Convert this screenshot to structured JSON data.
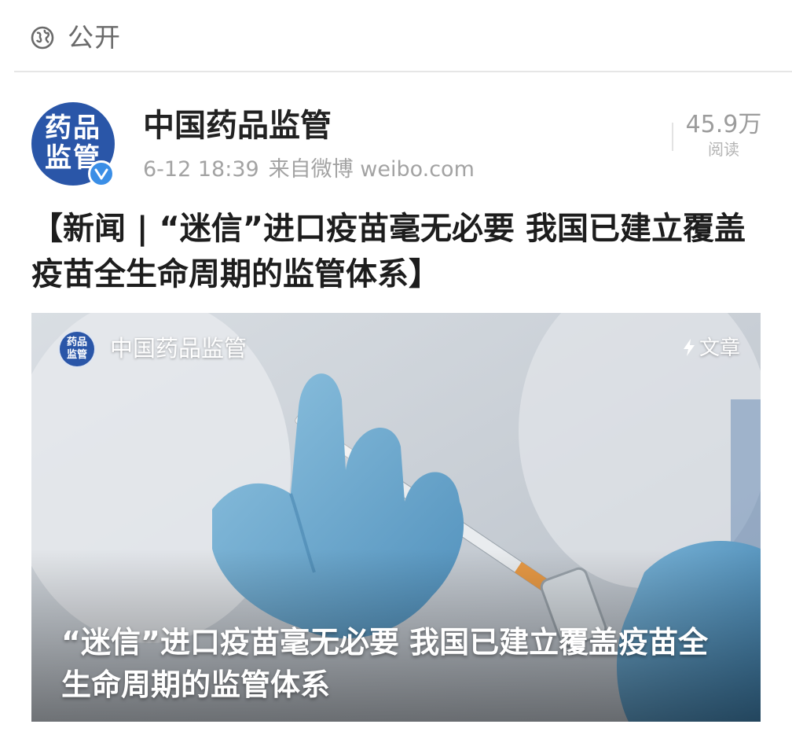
{
  "visibility": {
    "icon": "globe-icon",
    "label": "公开"
  },
  "account": {
    "avatar_text_line1": "药品",
    "avatar_text_line2": "监管",
    "avatar_color": "#2a56a8",
    "verified_icon": "verified-badge-icon",
    "verified_color": "#3a8ee6",
    "name": "中国药品监管",
    "date": "6-12 18:39",
    "source": "来自微博 weibo.com"
  },
  "stats": {
    "read_count": "45.9万",
    "read_label": "阅读"
  },
  "post": {
    "text": "【新闻 | “迷信”进口疫苗毫无必要 我国已建立覆盖疫苗全生命周期的监管体系】"
  },
  "article_card": {
    "source_avatar_text_line1": "药品",
    "source_avatar_text_line2": "监管",
    "source_name": "中国药品监管",
    "tag_icon": "lightning-icon",
    "tag_label": "文章",
    "title": "“迷信”进口疫苗毫无必要 我国已建立覆盖疫苗全生命周期的监管体系",
    "image_subject": "gloved-hands-syringe-vial"
  }
}
